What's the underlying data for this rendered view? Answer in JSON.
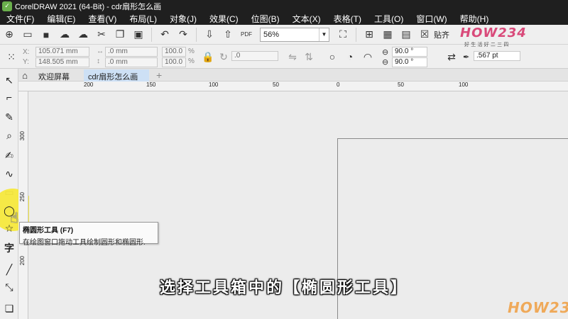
{
  "window": {
    "title": "CorelDRAW 2021 (64-Bit) - cdr扇形怎么画"
  },
  "menu": [
    "文件(F)",
    "编辑(E)",
    "查看(V)",
    "布局(L)",
    "对象(J)",
    "效果(C)",
    "位图(B)",
    "文本(X)",
    "表格(T)",
    "工具(O)",
    "窗口(W)",
    "帮助(H)"
  ],
  "toolbar": {
    "zoom": "56%",
    "snap_label": "贴齐",
    "pdf_label": "PDF"
  },
  "property_bar": {
    "x_label": "X:",
    "y_label": "Y:",
    "x_value": "105.071 mm",
    "y_value": "148.505 mm",
    "w_value": ".0 mm",
    "h_value": ".0 mm",
    "scale_w": "100.0",
    "scale_h": "100.0",
    "pct": "%",
    "angle": ".0",
    "start_angle": "90.0 °",
    "end_angle": "90.0 °",
    "outline": ".567 pt"
  },
  "tabs": {
    "welcome": "欢迎屏幕",
    "document": "cdr扇形怎么画",
    "add": "+"
  },
  "ruler": {
    "h_ticks": [
      "200",
      "150",
      "100",
      "50",
      "0",
      "50",
      "100"
    ],
    "v_ticks": [
      "300",
      "250",
      "200"
    ]
  },
  "tooltip": {
    "title": "椭圆形工具 (F7)",
    "description": "在绘图窗口拖动工具绘制圆形和椭圆形."
  },
  "subtitle": "选择工具箱中的【椭圆形工具】",
  "watermark": {
    "brand": "HOW234",
    "sub": "好 生 活 好 二 三 四"
  },
  "colors": {
    "highlight": "#f6e83c",
    "dark_bar": "#1f1f1f",
    "active_tab": "#cde0f5"
  }
}
